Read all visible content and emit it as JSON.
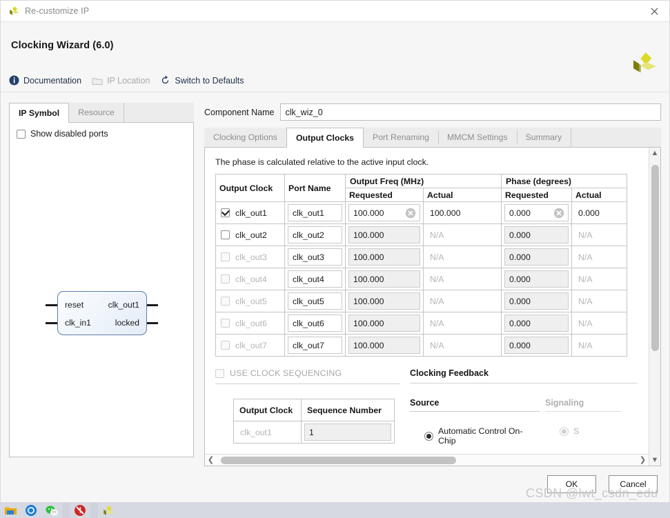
{
  "window": {
    "titlebar_text": "Re-customize IP",
    "titlebar_logo_icon": "xilinx-logo-icon",
    "close_icon": "close-icon",
    "page_title": "Clocking Wizard (6.0)",
    "brand_logo_icon": "xilinx-logo-icon"
  },
  "toolbar": {
    "links": [
      {
        "label": "Documentation",
        "icon": "info-icon",
        "disabled": false
      },
      {
        "label": "IP Location",
        "icon": "folder-icon",
        "disabled": true
      },
      {
        "label": "Switch to Defaults",
        "icon": "refresh-icon",
        "disabled": false
      }
    ]
  },
  "left_panel": {
    "tabs": [
      {
        "label": "IP Symbol",
        "active": true
      },
      {
        "label": "Resource",
        "active": false
      }
    ],
    "show_disabled_ports": {
      "label": "Show disabled ports",
      "checked": false
    },
    "ip_symbol": {
      "left_ports": [
        "reset",
        "clk_in1"
      ],
      "right_ports": [
        "clk_out1",
        "locked"
      ]
    }
  },
  "component_name": {
    "label": "Component Name",
    "value": "clk_wiz_0",
    "placeholder": "clk_wiz_0"
  },
  "main_tabs": [
    {
      "label": "Clocking Options",
      "active": false
    },
    {
      "label": "Output Clocks",
      "active": true
    },
    {
      "label": "Port Renaming",
      "active": false
    },
    {
      "label": "MMCM Settings",
      "active": false
    },
    {
      "label": "Summary",
      "active": false
    }
  ],
  "output_clocks": {
    "phase_note": "The phase is calculated relative to the active input clock.",
    "group_headers": {
      "output_clock": "Output Clock",
      "port_name": "Port Name",
      "output_freq": "Output Freq (MHz)",
      "phase": "Phase (degrees)",
      "requested": "Requested",
      "actual": "Actual"
    },
    "clear_icon": "clear-circle-icon",
    "na_text": "N/A",
    "rows": [
      {
        "clock": "clk_out1",
        "enabled": true,
        "row_disabled": false,
        "port_name": "clk_out1",
        "freq_requested": "100.000",
        "freq_actual": "100.000",
        "phase_requested": "0.000",
        "phase_actual": "0.000",
        "has_clear": true
      },
      {
        "clock": "clk_out2",
        "enabled": false,
        "row_disabled": false,
        "port_name": "clk_out2",
        "freq_requested": "100.000",
        "freq_actual": "N/A",
        "phase_requested": "0.000",
        "phase_actual": "N/A",
        "has_clear": false
      },
      {
        "clock": "clk_out3",
        "enabled": false,
        "row_disabled": true,
        "port_name": "clk_out3",
        "freq_requested": "100.000",
        "freq_actual": "N/A",
        "phase_requested": "0.000",
        "phase_actual": "N/A",
        "has_clear": false
      },
      {
        "clock": "clk_out4",
        "enabled": false,
        "row_disabled": true,
        "port_name": "clk_out4",
        "freq_requested": "100.000",
        "freq_actual": "N/A",
        "phase_requested": "0.000",
        "phase_actual": "N/A",
        "has_clear": false
      },
      {
        "clock": "clk_out5",
        "enabled": false,
        "row_disabled": true,
        "port_name": "clk_out5",
        "freq_requested": "100.000",
        "freq_actual": "N/A",
        "phase_requested": "0.000",
        "phase_actual": "N/A",
        "has_clear": false
      },
      {
        "clock": "clk_out6",
        "enabled": false,
        "row_disabled": true,
        "port_name": "clk_out6",
        "freq_requested": "100.000",
        "freq_actual": "N/A",
        "phase_requested": "0.000",
        "phase_actual": "N/A",
        "has_clear": false
      },
      {
        "clock": "clk_out7",
        "enabled": false,
        "row_disabled": true,
        "port_name": "clk_out7",
        "freq_requested": "100.000",
        "freq_actual": "N/A",
        "phase_requested": "0.000",
        "phase_actual": "N/A",
        "has_clear": false
      }
    ]
  },
  "clock_sequencing": {
    "checkbox_label": "USE CLOCK SEQUENCING",
    "checked": false,
    "disabled": true,
    "table_headers": [
      "Output Clock",
      "Sequence Number"
    ],
    "rows": [
      {
        "clock": "clk_out1",
        "sequence_number": "1"
      }
    ]
  },
  "clocking_feedback": {
    "title": "Clocking Feedback",
    "source_header": "Source",
    "signaling_header": "Signaling",
    "source_options": [
      {
        "label": "Automatic Control On-Chip",
        "selected": true,
        "disabled": false
      }
    ],
    "signaling_options": [
      {
        "label": "S",
        "selected": true,
        "disabled": true
      }
    ]
  },
  "scrollbars": {
    "vertical": {
      "up_icon": "chevron-up-icon",
      "down_icon": "chevron-down-icon",
      "thumb_top_pct": 2,
      "thumb_height_pct": 63
    },
    "horizontal": {
      "left_icon": "chevron-left-icon",
      "right_icon": "chevron-right-icon",
      "thumb_left_pct": 1,
      "thumb_width_pct": 56
    }
  },
  "footer": {
    "ok_label": "OK",
    "cancel_label": "Cancel"
  },
  "watermark": "CSDN @lwt_csdn_edu",
  "taskbar": {
    "items": [
      {
        "icon": "file-explorer-icon"
      },
      {
        "icon": "edge-browser-icon"
      },
      {
        "icon": "wechat-icon"
      },
      {
        "icon": "red-app-icon"
      },
      {
        "icon": "vivado-icon"
      }
    ]
  },
  "colors": {
    "accent_blue": "#21324e",
    "brand_yellow": "#d4d400",
    "brand_olive": "#7d7d06",
    "symbol_border": "#5b7ca8",
    "disabled_gray": "#b4b4b4"
  }
}
